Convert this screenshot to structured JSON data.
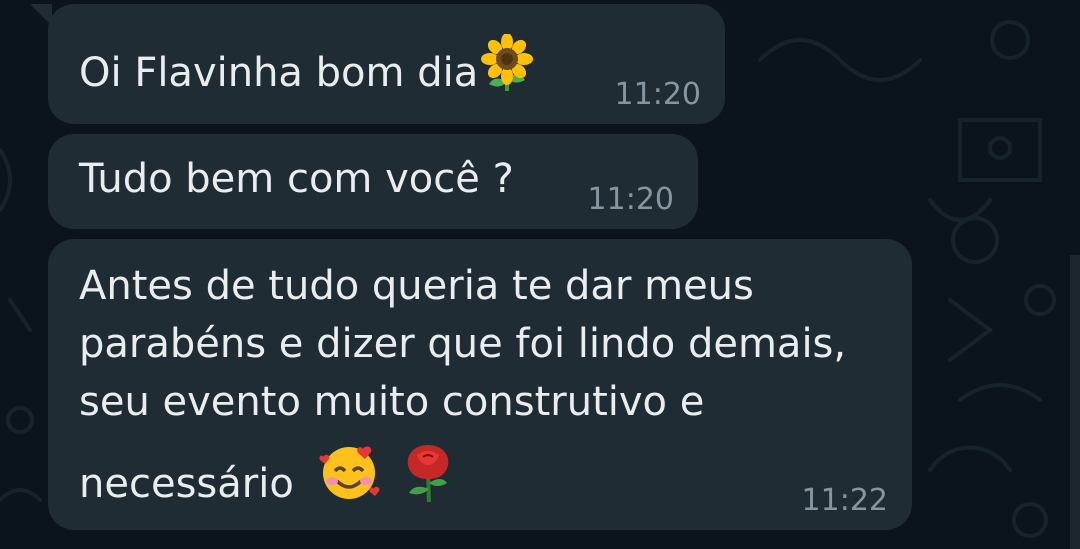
{
  "chat": {
    "messages": [
      {
        "text": "Oi Flavinha bom dia",
        "emojis": [
          "sunflower-emoji"
        ],
        "time": "11:20"
      },
      {
        "text": "Tudo bem com você ?",
        "emojis": [],
        "time": "11:20"
      },
      {
        "lines": [
          "Antes de tudo queria te dar meus",
          "parabéns e dizer que foi lindo demais,",
          "seu evento muito construtivo e",
          "necessário"
        ],
        "emojis": [
          "smiling-face-with-hearts-emoji",
          "rose-emoji"
        ],
        "time": "11:22"
      }
    ]
  },
  "colors": {
    "background": "#0b141a",
    "bubble": "#202c33",
    "text": "#e9edef",
    "timestamp": "#8696a0"
  }
}
